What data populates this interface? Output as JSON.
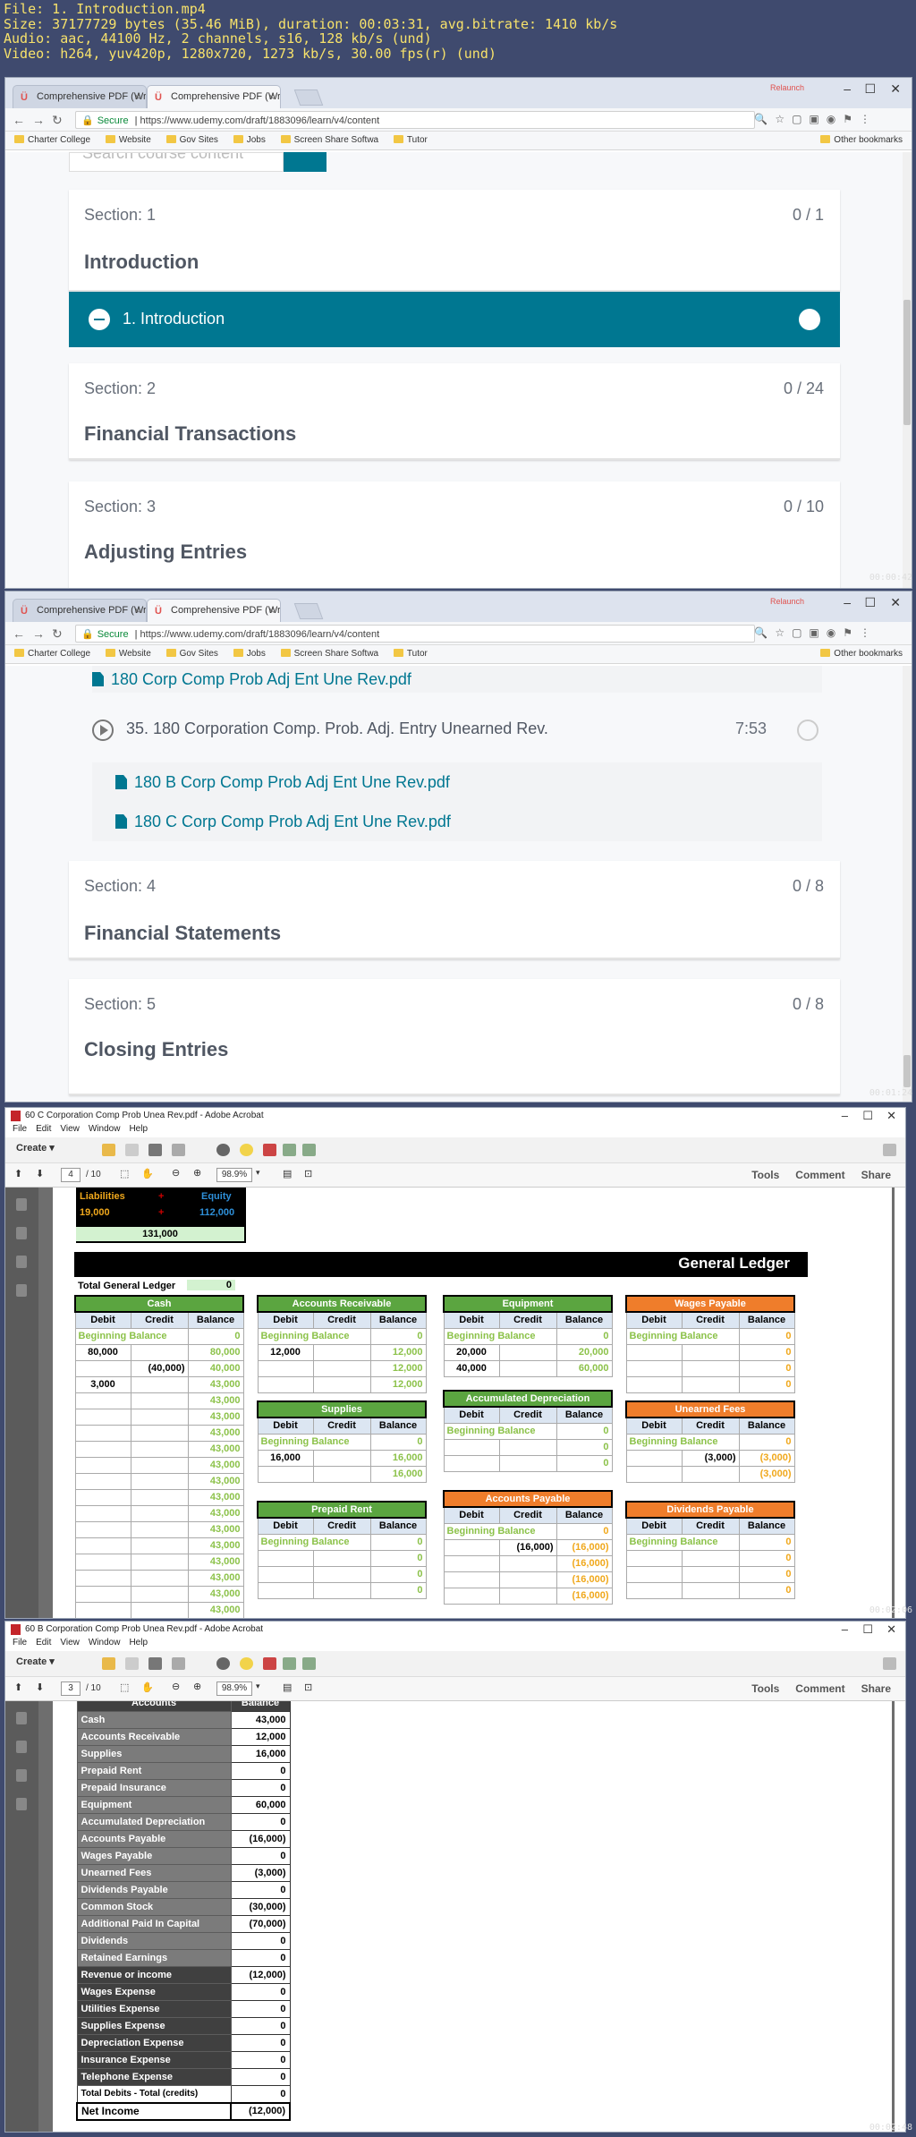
{
  "video_info": {
    "line1": "File: 1. Introduction.mp4",
    "line2": "Size: 37177729 bytes (35.46 MiB), duration: 00:03:31, avg.bitrate: 1410 kb/s",
    "line3": "Audio: aac, 44100 Hz, 2 channels, s16, 128 kb/s (und)",
    "line4": "Video: h264, yuv420p, 1280x720, 1273 kb/s, 30.00 fps(r) (und)"
  },
  "browser": {
    "tabs": [
      "Comprehensive PDF (Wr",
      "Comprehensive PDF (Wr"
    ],
    "secure": "Secure",
    "url": "https://www.udemy.com/draft/1883096/learn/v4/content",
    "bookmarks": [
      "Charter College",
      "Website",
      "Gov Sites",
      "Jobs",
      "Screen Share Softwa",
      "Tutor"
    ],
    "other_bookmarks": "Other bookmarks",
    "relaunch": "Relaunch",
    "search_placeholder": "Search course content"
  },
  "frame1": {
    "section1": {
      "label": "Section: 1",
      "count": "0 / 1",
      "title": "Introduction"
    },
    "lecture": "1. Introduction",
    "section2": {
      "label": "Section: 2",
      "count": "0 / 24",
      "title": "Financial Transactions"
    },
    "section3": {
      "label": "Section: 3",
      "count": "0 / 10",
      "title": "Adjusting Entries"
    }
  },
  "frame2": {
    "res0": "180 Corp Comp Prob Adj Ent Une Rev.pdf",
    "lecture35": "35. 180 Corporation Comp. Prob. Adj. Entry Unearned Rev.",
    "lecture35_time": "7:53",
    "res1": "180 B Corp Comp Prob Adj Ent Une Rev.pdf",
    "res2": "180 C Corp Comp Prob Adj Ent Une Rev.pdf",
    "section4": {
      "label": "Section: 4",
      "count": "0 / 8",
      "title": "Financial Statements"
    },
    "section5": {
      "label": "Section: 5",
      "count": "0 / 8",
      "title": "Closing Entries"
    }
  },
  "acrobat": {
    "menu": [
      "File",
      "Edit",
      "View",
      "Window",
      "Help"
    ],
    "create": "Create",
    "links": [
      "Tools",
      "Comment",
      "Share"
    ],
    "zoom": "98.9%"
  },
  "acro1": {
    "title": "60 C Corporation Comp Prob  Unea Rev.pdf - Adobe Acrobat",
    "page": "4",
    "of": "/ 10",
    "liabilities": "Liabilities",
    "liab_val": "19,000",
    "equity": "Equity",
    "equity_val": "112,000",
    "plus": "+",
    "total": "131,000",
    "gl_title": "General Ledger",
    "total_gl_label": "Total General Ledger",
    "total_gl_val": "0",
    "col": {
      "debit": "Debit",
      "credit": "Credit",
      "balance": "Balance"
    },
    "bb": "Beginning Balance",
    "cash": {
      "name": "Cash",
      "rows": [
        [
          "Beginning Balance",
          "",
          "0"
        ],
        [
          "80,000",
          "",
          "80,000"
        ],
        [
          "",
          "(40,000)",
          "40,000"
        ],
        [
          "3,000",
          "",
          "43,000"
        ],
        [
          "",
          "",
          "43,000"
        ],
        [
          "",
          "",
          "43,000"
        ],
        [
          "",
          "",
          "43,000"
        ],
        [
          "",
          "",
          "43,000"
        ],
        [
          "",
          "",
          "43,000"
        ],
        [
          "",
          "",
          "43,000"
        ],
        [
          "",
          "",
          "43,000"
        ],
        [
          "",
          "",
          "43,000"
        ],
        [
          "",
          "",
          "43,000"
        ],
        [
          "",
          "",
          "43,000"
        ],
        [
          "",
          "",
          "43,000"
        ],
        [
          "",
          "",
          "43,000"
        ],
        [
          "",
          "",
          "43,000"
        ],
        [
          "",
          "",
          "43,000"
        ]
      ]
    },
    "ar": {
      "name": "Accounts Receivable",
      "rows": [
        [
          "Beginning Balance",
          "",
          "0"
        ],
        [
          "12,000",
          "",
          "12,000"
        ],
        [
          "",
          "",
          "12,000"
        ],
        [
          "",
          "",
          "12,000"
        ]
      ]
    },
    "equip": {
      "name": "Equipment",
      "rows": [
        [
          "Beginning Balance",
          "",
          "0"
        ],
        [
          "20,000",
          "",
          "20,000"
        ],
        [
          "40,000",
          "",
          "60,000"
        ]
      ]
    },
    "wages": {
      "name": "Wages Payable",
      "rows": [
        [
          "Beginning Balance",
          "",
          "0"
        ],
        [
          "",
          "",
          "0"
        ],
        [
          "",
          "",
          "0"
        ],
        [
          "",
          "",
          "0"
        ]
      ]
    },
    "supplies": {
      "name": "Supplies",
      "rows": [
        [
          "Beginning Balance",
          "",
          "0"
        ],
        [
          "16,000",
          "",
          "16,000"
        ],
        [
          "",
          "",
          "16,000"
        ]
      ]
    },
    "accdep": {
      "name": "Accumulated Depreciation",
      "rows": [
        [
          "Beginning Balance",
          "",
          "0"
        ],
        [
          "",
          "",
          "0"
        ],
        [
          "",
          "",
          "0"
        ]
      ]
    },
    "unearned": {
      "name": "Unearned Fees",
      "rows": [
        [
          "Beginning Balance",
          "",
          "0"
        ],
        [
          "",
          "(3,000)",
          "(3,000)"
        ],
        [
          "",
          "",
          "(3,000)"
        ]
      ]
    },
    "prepaid": {
      "name": "Prepaid Rent",
      "rows": [
        [
          "Beginning Balance",
          "",
          "0"
        ],
        [
          "",
          "",
          "0"
        ],
        [
          "",
          "",
          "0"
        ],
        [
          "",
          "",
          "0"
        ]
      ]
    },
    "ap": {
      "name": "Accounts Payable",
      "rows": [
        [
          "Beginning Balance",
          "",
          "0"
        ],
        [
          "",
          "(16,000)",
          "(16,000)"
        ],
        [
          "",
          "",
          "(16,000)"
        ],
        [
          "",
          "",
          "(16,000)"
        ],
        [
          "",
          "",
          "(16,000)"
        ]
      ]
    },
    "divpay": {
      "name": "Dividends Payable",
      "rows": [
        [
          "Beginning Balance",
          "",
          "0"
        ],
        [
          "",
          "",
          "0"
        ],
        [
          "",
          "",
          "0"
        ],
        [
          "",
          "",
          "0"
        ]
      ]
    }
  },
  "acro2": {
    "title": "60 B Corporation Comp Prob  Unea Rev.pdf - Adobe Acrobat",
    "page": "3",
    "of": "/ 10",
    "header_accounts": "Accounts",
    "header_balance": "Balance",
    "rows": [
      [
        "Cash",
        "43,000"
      ],
      [
        "Accounts Receivable",
        "12,000"
      ],
      [
        "Supplies",
        "16,000"
      ],
      [
        "Prepaid Rent",
        "0"
      ],
      [
        "Prepaid Insurance",
        "0"
      ],
      [
        "Equipment",
        "60,000"
      ],
      [
        "Accumulated Depreciation",
        "0"
      ],
      [
        "Accounts Payable",
        "(16,000)"
      ],
      [
        "Wages Payable",
        "0"
      ],
      [
        "Unearned Fees",
        "(3,000)"
      ],
      [
        "Dividends Payable",
        "0"
      ],
      [
        "Common Stock",
        "(30,000)"
      ],
      [
        "Additional Paid In Capital",
        "(70,000)"
      ],
      [
        "Dividends",
        "0"
      ],
      [
        "Retained Earnings",
        "0"
      ],
      [
        "Revenue or income",
        "(12,000)"
      ],
      [
        "Wages Expense",
        "0"
      ],
      [
        "Utilities Expense",
        "0"
      ],
      [
        "Supplies Expense",
        "0"
      ],
      [
        "Depreciation Expense",
        "0"
      ],
      [
        "Insurance Expense",
        "0"
      ],
      [
        "Telephone Expense",
        "0"
      ]
    ],
    "total_label": "Total Debits - Total (credits)",
    "total_val": "0",
    "net_label": "Net Income",
    "net_val": "(12,000)"
  },
  "timestamps": [
    "00:00:42",
    "00:01:24",
    "00:02:06",
    "00:02:48"
  ]
}
